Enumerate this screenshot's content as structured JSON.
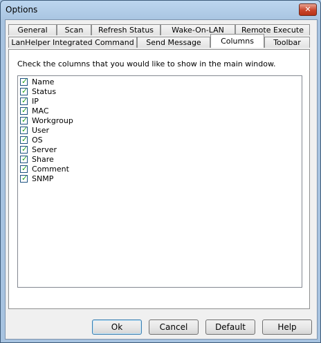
{
  "window": {
    "title": "Options",
    "close_glyph": "✕"
  },
  "tabs_row1": [
    "General",
    "Scan",
    "Refresh Status",
    "Wake-On-LAN",
    "Remote Execute"
  ],
  "tabs_row2": [
    "LanHelper Integrated Command",
    "Send Message",
    "Columns",
    "Toolbar"
  ],
  "active_tab": "Columns",
  "panel": {
    "instruction": "Check the columns that you would like to show in the main window.",
    "columns": [
      {
        "label": "Name",
        "checked": true
      },
      {
        "label": "Status",
        "checked": true
      },
      {
        "label": "IP",
        "checked": true
      },
      {
        "label": "MAC",
        "checked": true
      },
      {
        "label": "Workgroup",
        "checked": true
      },
      {
        "label": "User",
        "checked": true
      },
      {
        "label": "OS",
        "checked": true
      },
      {
        "label": "Server",
        "checked": true
      },
      {
        "label": "Share",
        "checked": true
      },
      {
        "label": "Comment",
        "checked": true
      },
      {
        "label": "SNMP",
        "checked": true
      }
    ]
  },
  "buttons": {
    "ok": "Ok",
    "cancel": "Cancel",
    "default": "Default",
    "help": "Help"
  },
  "check_glyph": "✓",
  "colors": {
    "check": "#21a121",
    "title_bar": "#a7c3e0",
    "close": "#c9452b"
  }
}
